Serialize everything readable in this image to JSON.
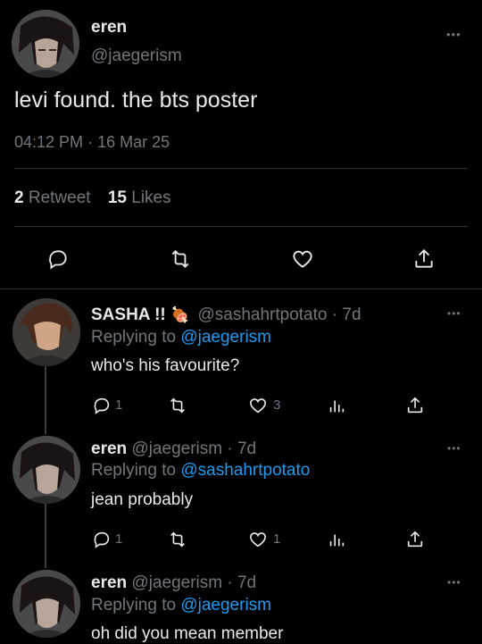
{
  "main_tweet": {
    "name": "eren",
    "handle": "@jaegerism",
    "text": "levi found. the bts poster",
    "time": "04:12 PM",
    "date": "16 Mar 25",
    "retweets_count": "2",
    "retweets_label": "Retweet",
    "likes_count": "15",
    "likes_label": "Likes"
  },
  "replies": [
    {
      "name": "SASHA !!",
      "emoji": "🍖",
      "handle": "@sashahrtpotato",
      "age": "7d",
      "replying_label": "Replying to",
      "replying_to": "@jaegerism",
      "text": "who's his favourite?",
      "reply_count": "1",
      "like_count": "3"
    },
    {
      "name": "eren",
      "handle": "@jaegerism",
      "age": "7d",
      "replying_label": "Replying to",
      "replying_to": "@sashahrtpotato",
      "text": "jean probably",
      "reply_count": "1",
      "like_count": "1"
    },
    {
      "name": "eren",
      "handle": "@jaegerism",
      "age": "7d",
      "replying_label": "Replying to",
      "replying_to": "@jaegerism",
      "text": "oh did you mean member"
    }
  ],
  "separator": "·",
  "more_glyph": "•••",
  "icons": [
    "comment-icon",
    "retweet-icon",
    "heart-icon",
    "share-icon",
    "analytics-icon",
    "more-icon"
  ],
  "colors": {
    "background": "#000000",
    "text": "#e7e9ea",
    "muted": "#71767b",
    "link": "#1d9bf0",
    "divider": "#2f3336"
  }
}
